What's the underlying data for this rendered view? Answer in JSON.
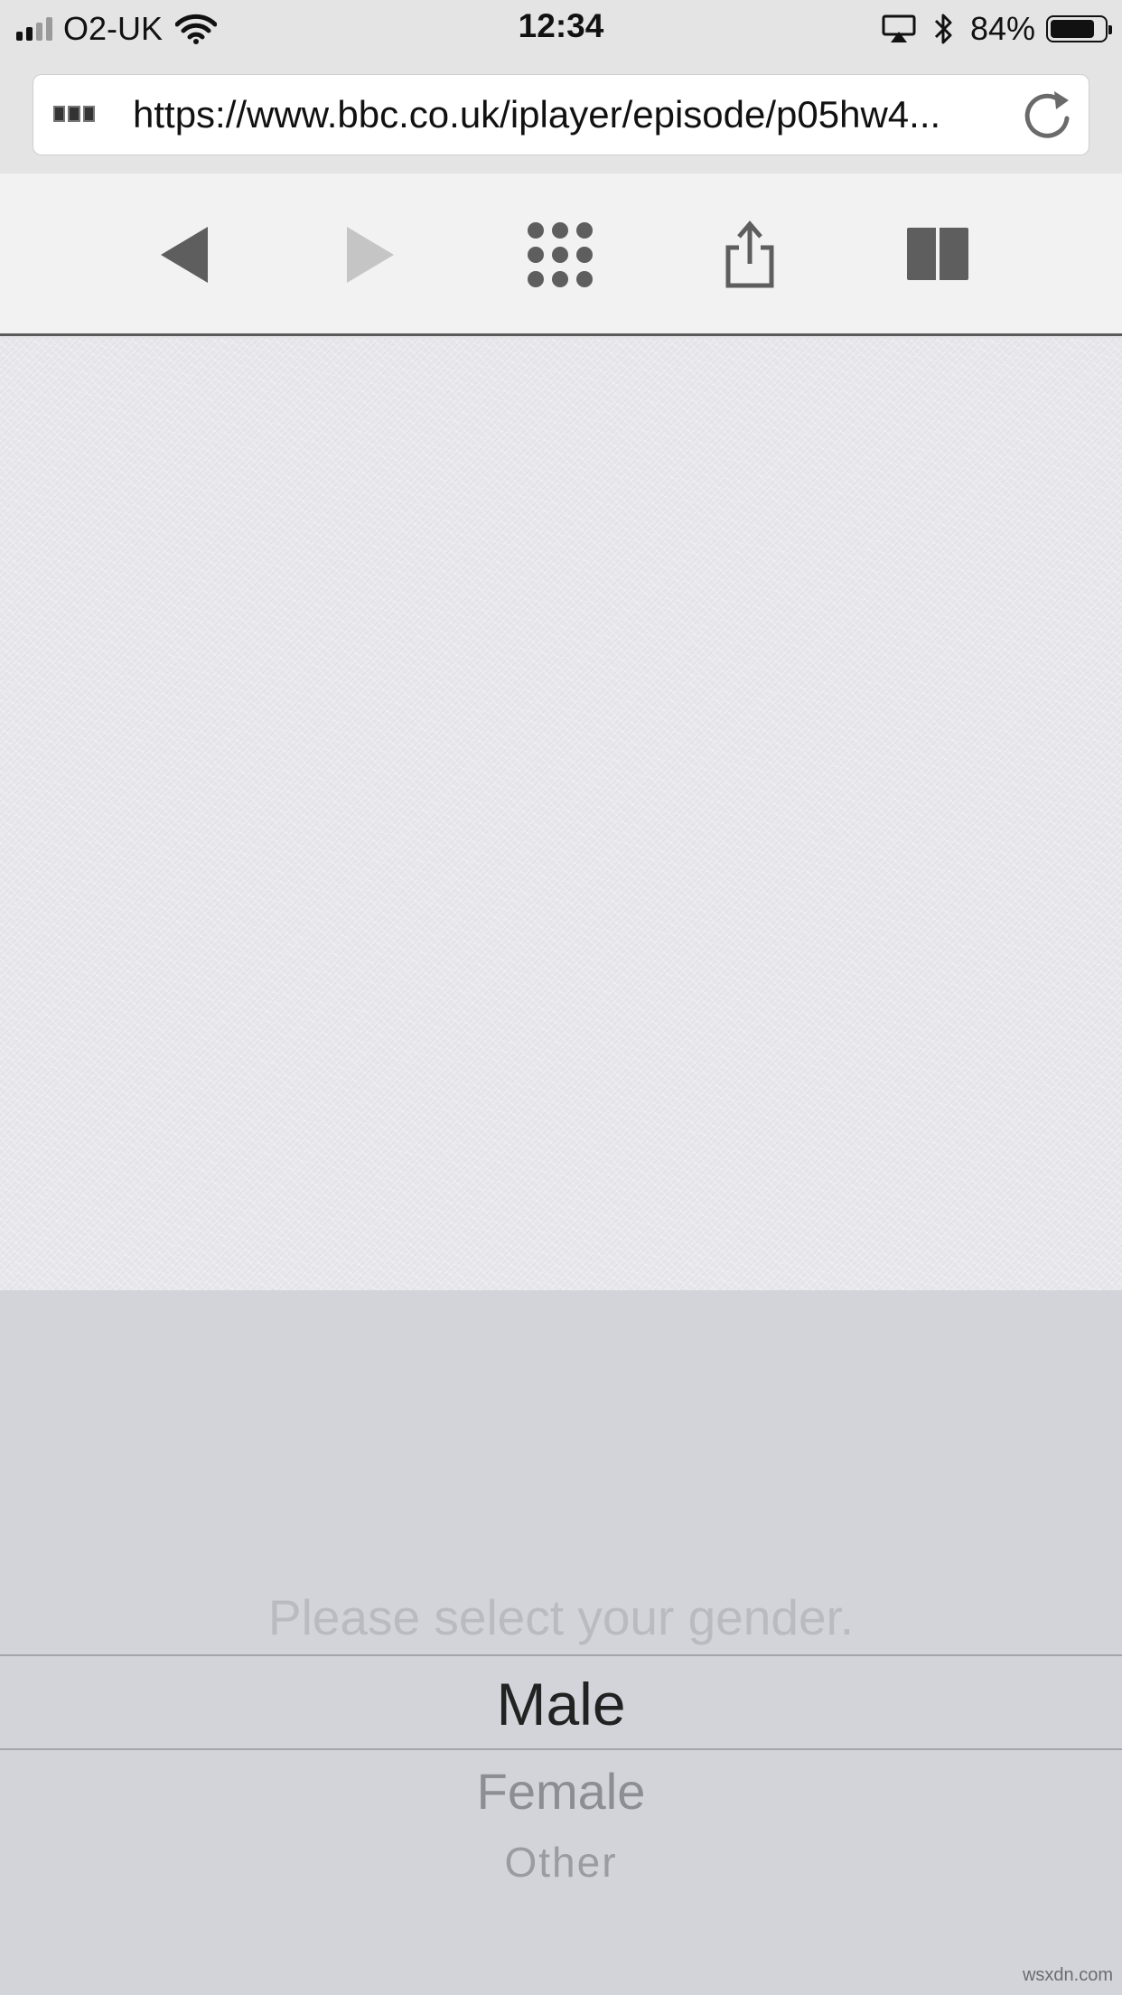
{
  "status_bar": {
    "carrier": "O2-UK",
    "time": "12:34",
    "battery_percent": "84%",
    "battery_level": 0.84,
    "icons": [
      "signal-icon",
      "wifi-icon",
      "airplay-icon",
      "bluetooth-icon",
      "battery-icon"
    ]
  },
  "address_bar": {
    "url": "https://www.bbc.co.uk/iplayer/episode/p05hw4...",
    "icons": [
      "bbc-favicon",
      "reload-icon"
    ]
  },
  "toolbar": {
    "icons": [
      "back-icon",
      "forward-icon",
      "tabs-grid-icon",
      "share-icon",
      "bookmarks-icon"
    ]
  },
  "picker": {
    "prompt": "Please select your gender.",
    "options": [
      "Male",
      "Female",
      "Other"
    ],
    "selected": "Male"
  },
  "watermark": "wsxdn.com",
  "colors": {
    "picker_background": "#d2d4da",
    "toolbar_background": "#f2f2f2",
    "status_background": "#e4e4e4"
  }
}
